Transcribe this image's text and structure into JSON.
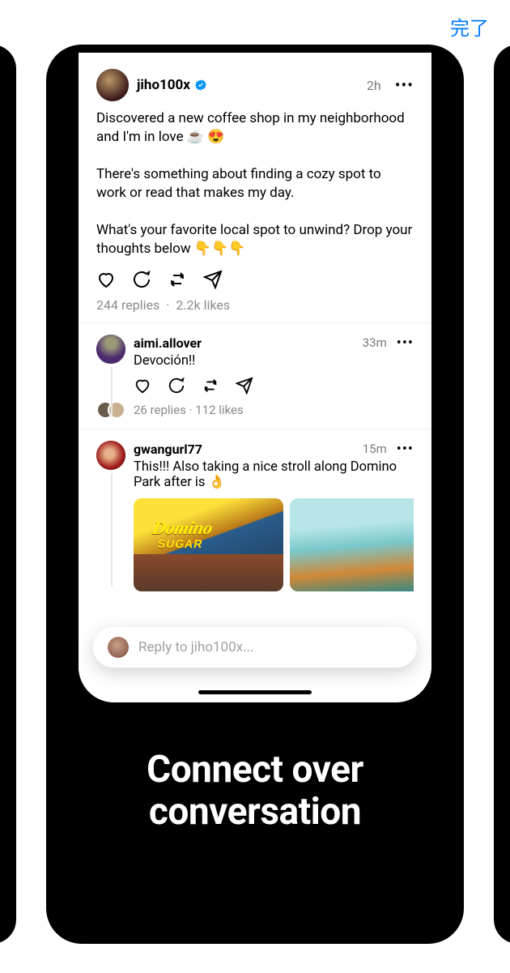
{
  "done_label": "完了",
  "post": {
    "username": "jiho100x",
    "verified": true,
    "time": "2h",
    "body": "Discovered a new coffee shop in my neighborhood and I'm in love ☕ 😍\n\nThere's something about finding a cozy spot to work or read that makes my day.\n\nWhat's your favorite local spot to unwind? Drop your thoughts below 👇👇👇",
    "replies_label": "244 replies",
    "likes_label": "2.2k likes"
  },
  "reply1": {
    "username": "aimi.allover",
    "time": "33m",
    "body": "Devoción!!",
    "replies_label": "26 replies",
    "likes_label": "112 likes"
  },
  "reply2": {
    "username": "gwangurl77",
    "time": "15m",
    "body": "This!!! Also taking a nice stroll along Domino Park after is 👌",
    "img_sign_line1": "Domino",
    "img_sign_line2": "SUGAR"
  },
  "reply_placeholder": "Reply to jiho100x...",
  "tagline": "Connect over\nconversation"
}
